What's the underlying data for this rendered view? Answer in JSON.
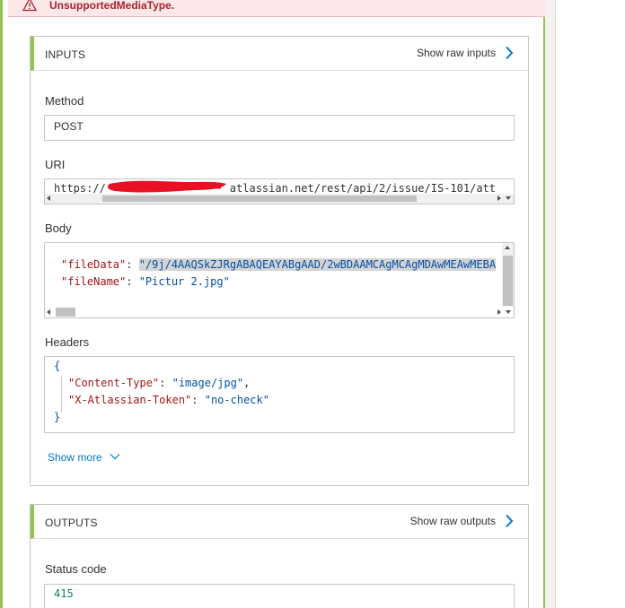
{
  "error": {
    "message": "UnsupportedMediaType.",
    "icon": "warning-icon"
  },
  "inputs": {
    "title": "INPUTS",
    "raw_link": "Show raw inputs",
    "method_label": "Method",
    "method_value": "POST",
    "uri_label": "URI",
    "uri_prefix": "https://",
    "uri_suffix": "atlassian.net/rest/api/2/issue/IS-101/att",
    "body_label": "Body",
    "body_line1": {
      "key": "\"fileData\"",
      "sep": ": ",
      "value": "\"/9j/4AAQSkZJRgABAQEAYABgAAD/2wBDAAMCAgMCAgMDAwMEAwMEBA"
    },
    "body_line2": {
      "key": "\"fileName\"",
      "sep": ": ",
      "value": "\"Pictur 2.jpg\""
    },
    "headers_label": "Headers",
    "headers_open": "{",
    "headers_line1": {
      "key": "\"Content-Type\"",
      "sep": ": ",
      "value": "\"image/jpg\"",
      "comma": ","
    },
    "headers_line2": {
      "key": "\"X-Atlassian-Token\"",
      "sep": ": ",
      "value": "\"no-check\""
    },
    "headers_close": "}",
    "show_more": "Show more"
  },
  "outputs": {
    "title": "OUTPUTS",
    "raw_link": "Show raw outputs",
    "status_label": "Status code",
    "status_value": "415"
  },
  "colors": {
    "success_border": "#92c353",
    "error_bg": "#fde7e9",
    "link_blue": "#0078d4"
  }
}
